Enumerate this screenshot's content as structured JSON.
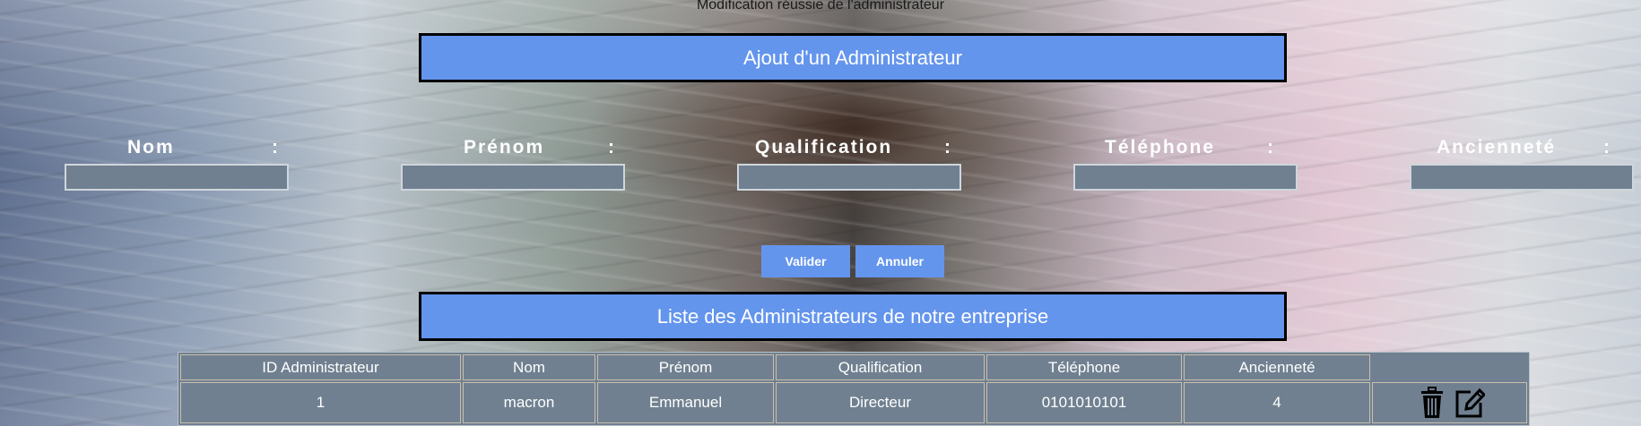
{
  "status_message": "Modification réussie de l'administrateur",
  "form": {
    "title": "Ajout d'un Administrateur",
    "fields": [
      {
        "label": "Nom",
        "colon": ":",
        "value": ""
      },
      {
        "label": "Prénom",
        "colon": ":",
        "value": ""
      },
      {
        "label": "Qualification",
        "colon": ":",
        "value": ""
      },
      {
        "label": "Téléphone",
        "colon": ":",
        "value": ""
      },
      {
        "label": "Ancienneté",
        "colon": ":",
        "value": ""
      }
    ],
    "validate_label": "Valider",
    "cancel_label": "Annuler"
  },
  "list": {
    "title": "Liste des Administrateurs de notre entreprise",
    "headers": [
      "ID Administrateur",
      "Nom",
      "Prénom",
      "Qualification",
      "Téléphone",
      "Ancienneté",
      ""
    ],
    "rows": [
      {
        "id": "1",
        "nom": "macron",
        "prenom": "Emmanuel",
        "qualification": "Directeur",
        "telephone": "0101010101",
        "anciennete": "4"
      }
    ],
    "row_icons": [
      "trash-icon",
      "edit-icon"
    ]
  },
  "colors": {
    "accent": "#6495ed",
    "field_bg": "#708090"
  }
}
